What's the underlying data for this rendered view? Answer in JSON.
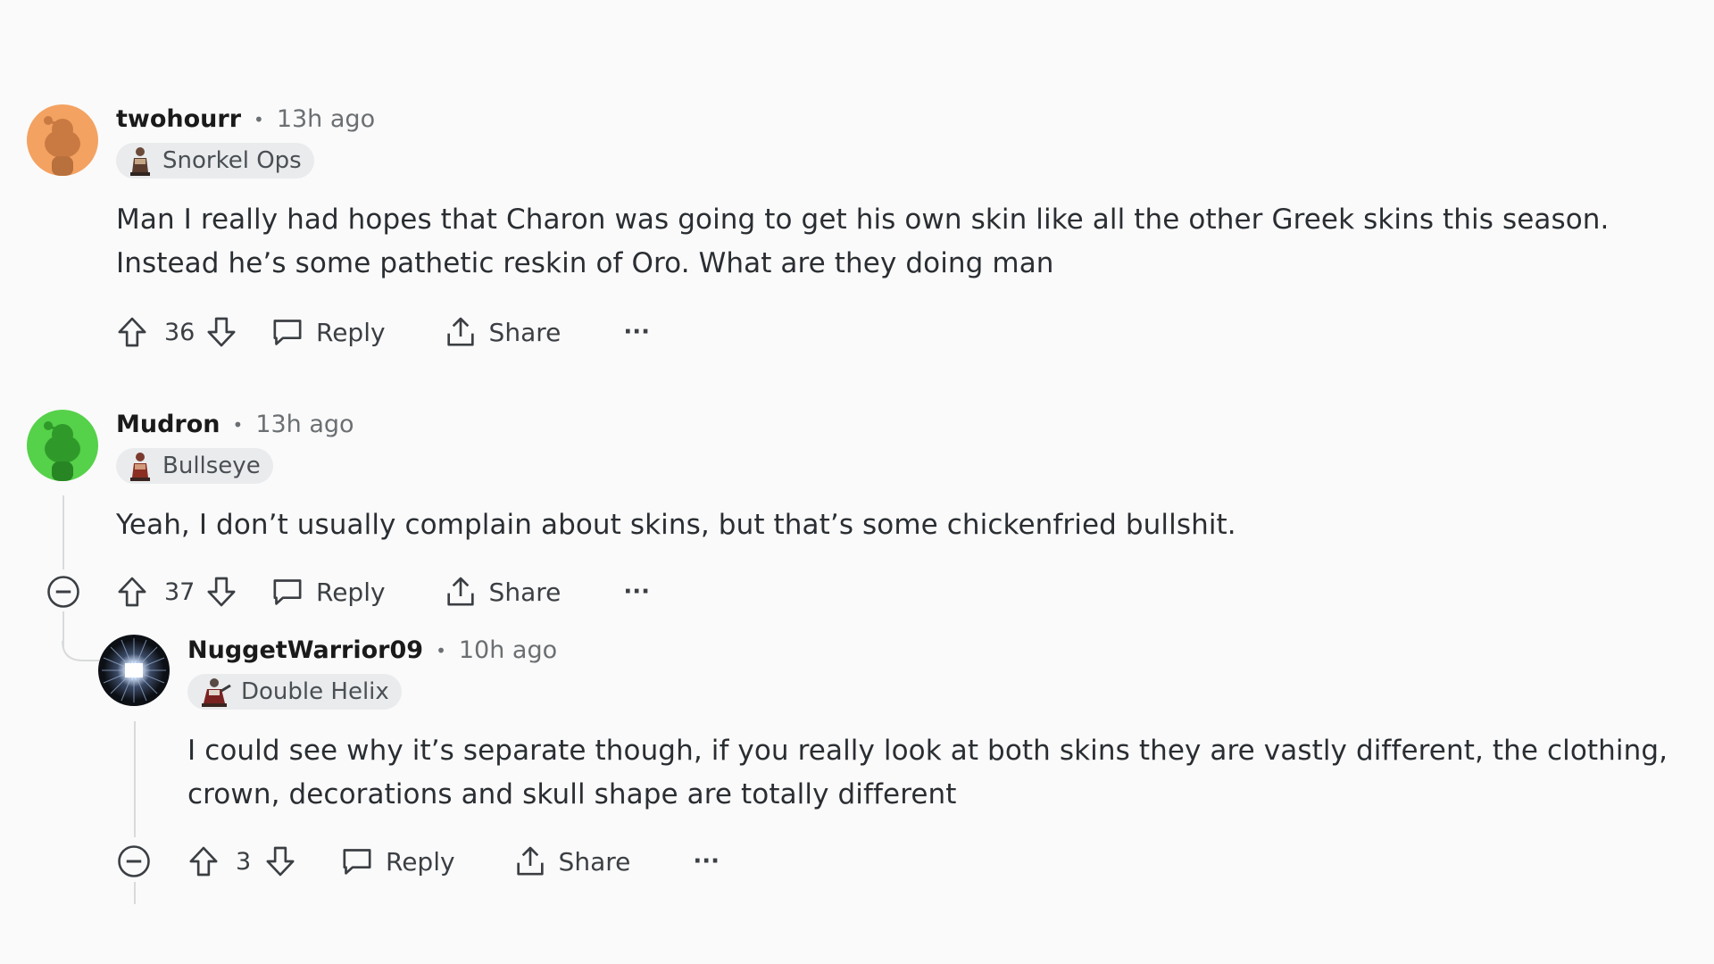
{
  "comments": [
    {
      "username": "twohourr",
      "time": "13h ago",
      "flair": "Snorkel Ops",
      "body": "Man I really had hopes that Charon was going to get his own skin like all the other Greek skins this season. Instead he’s some pathetic reskin of Oro. What are they doing man",
      "score": "36",
      "reply_label": "Reply",
      "share_label": "Share",
      "avatar_color": "#f4a261"
    },
    {
      "username": "Mudron",
      "time": "13h ago",
      "flair": "Bullseye",
      "body": "Yeah, I don’t usually complain about skins, but that’s some chickenfried bullshit.",
      "score": "37",
      "reply_label": "Reply",
      "share_label": "Share",
      "avatar_color": "#55d14a"
    },
    {
      "username": "NuggetWarrior09",
      "time": "10h ago",
      "flair": "Double Helix",
      "body": "I could see why it’s separate though, if you really look at both skins they are vastly different, the clothing, crown, decorations and skull shape are totally different",
      "score": "3",
      "reply_label": "Reply",
      "share_label": "Share",
      "avatar_color": "#0c0f14"
    }
  ],
  "separator": "•",
  "more_label": "···"
}
